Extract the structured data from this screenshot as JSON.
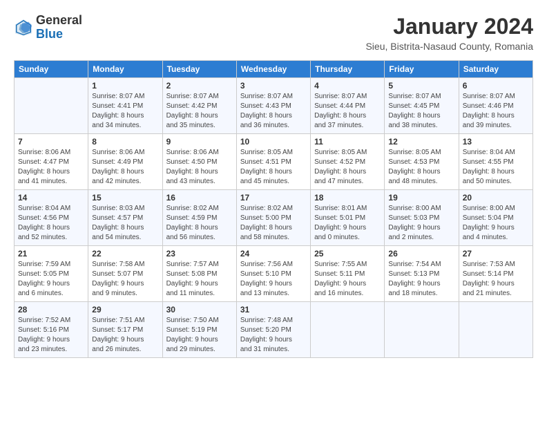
{
  "logo": {
    "general": "General",
    "blue": "Blue"
  },
  "header": {
    "title": "January 2024",
    "location": "Sieu, Bistrita-Nasaud County, Romania"
  },
  "weekdays": [
    "Sunday",
    "Monday",
    "Tuesday",
    "Wednesday",
    "Thursday",
    "Friday",
    "Saturday"
  ],
  "weeks": [
    [
      {
        "day": "",
        "info": ""
      },
      {
        "day": "1",
        "info": "Sunrise: 8:07 AM\nSunset: 4:41 PM\nDaylight: 8 hours\nand 34 minutes."
      },
      {
        "day": "2",
        "info": "Sunrise: 8:07 AM\nSunset: 4:42 PM\nDaylight: 8 hours\nand 35 minutes."
      },
      {
        "day": "3",
        "info": "Sunrise: 8:07 AM\nSunset: 4:43 PM\nDaylight: 8 hours\nand 36 minutes."
      },
      {
        "day": "4",
        "info": "Sunrise: 8:07 AM\nSunset: 4:44 PM\nDaylight: 8 hours\nand 37 minutes."
      },
      {
        "day": "5",
        "info": "Sunrise: 8:07 AM\nSunset: 4:45 PM\nDaylight: 8 hours\nand 38 minutes."
      },
      {
        "day": "6",
        "info": "Sunrise: 8:07 AM\nSunset: 4:46 PM\nDaylight: 8 hours\nand 39 minutes."
      }
    ],
    [
      {
        "day": "7",
        "info": "Sunrise: 8:06 AM\nSunset: 4:47 PM\nDaylight: 8 hours\nand 41 minutes."
      },
      {
        "day": "8",
        "info": "Sunrise: 8:06 AM\nSunset: 4:49 PM\nDaylight: 8 hours\nand 42 minutes."
      },
      {
        "day": "9",
        "info": "Sunrise: 8:06 AM\nSunset: 4:50 PM\nDaylight: 8 hours\nand 43 minutes."
      },
      {
        "day": "10",
        "info": "Sunrise: 8:05 AM\nSunset: 4:51 PM\nDaylight: 8 hours\nand 45 minutes."
      },
      {
        "day": "11",
        "info": "Sunrise: 8:05 AM\nSunset: 4:52 PM\nDaylight: 8 hours\nand 47 minutes."
      },
      {
        "day": "12",
        "info": "Sunrise: 8:05 AM\nSunset: 4:53 PM\nDaylight: 8 hours\nand 48 minutes."
      },
      {
        "day": "13",
        "info": "Sunrise: 8:04 AM\nSunset: 4:55 PM\nDaylight: 8 hours\nand 50 minutes."
      }
    ],
    [
      {
        "day": "14",
        "info": "Sunrise: 8:04 AM\nSunset: 4:56 PM\nDaylight: 8 hours\nand 52 minutes."
      },
      {
        "day": "15",
        "info": "Sunrise: 8:03 AM\nSunset: 4:57 PM\nDaylight: 8 hours\nand 54 minutes."
      },
      {
        "day": "16",
        "info": "Sunrise: 8:02 AM\nSunset: 4:59 PM\nDaylight: 8 hours\nand 56 minutes."
      },
      {
        "day": "17",
        "info": "Sunrise: 8:02 AM\nSunset: 5:00 PM\nDaylight: 8 hours\nand 58 minutes."
      },
      {
        "day": "18",
        "info": "Sunrise: 8:01 AM\nSunset: 5:01 PM\nDaylight: 9 hours\nand 0 minutes."
      },
      {
        "day": "19",
        "info": "Sunrise: 8:00 AM\nSunset: 5:03 PM\nDaylight: 9 hours\nand 2 minutes."
      },
      {
        "day": "20",
        "info": "Sunrise: 8:00 AM\nSunset: 5:04 PM\nDaylight: 9 hours\nand 4 minutes."
      }
    ],
    [
      {
        "day": "21",
        "info": "Sunrise: 7:59 AM\nSunset: 5:05 PM\nDaylight: 9 hours\nand 6 minutes."
      },
      {
        "day": "22",
        "info": "Sunrise: 7:58 AM\nSunset: 5:07 PM\nDaylight: 9 hours\nand 9 minutes."
      },
      {
        "day": "23",
        "info": "Sunrise: 7:57 AM\nSunset: 5:08 PM\nDaylight: 9 hours\nand 11 minutes."
      },
      {
        "day": "24",
        "info": "Sunrise: 7:56 AM\nSunset: 5:10 PM\nDaylight: 9 hours\nand 13 minutes."
      },
      {
        "day": "25",
        "info": "Sunrise: 7:55 AM\nSunset: 5:11 PM\nDaylight: 9 hours\nand 16 minutes."
      },
      {
        "day": "26",
        "info": "Sunrise: 7:54 AM\nSunset: 5:13 PM\nDaylight: 9 hours\nand 18 minutes."
      },
      {
        "day": "27",
        "info": "Sunrise: 7:53 AM\nSunset: 5:14 PM\nDaylight: 9 hours\nand 21 minutes."
      }
    ],
    [
      {
        "day": "28",
        "info": "Sunrise: 7:52 AM\nSunset: 5:16 PM\nDaylight: 9 hours\nand 23 minutes."
      },
      {
        "day": "29",
        "info": "Sunrise: 7:51 AM\nSunset: 5:17 PM\nDaylight: 9 hours\nand 26 minutes."
      },
      {
        "day": "30",
        "info": "Sunrise: 7:50 AM\nSunset: 5:19 PM\nDaylight: 9 hours\nand 29 minutes."
      },
      {
        "day": "31",
        "info": "Sunrise: 7:48 AM\nSunset: 5:20 PM\nDaylight: 9 hours\nand 31 minutes."
      },
      {
        "day": "",
        "info": ""
      },
      {
        "day": "",
        "info": ""
      },
      {
        "day": "",
        "info": ""
      }
    ]
  ]
}
